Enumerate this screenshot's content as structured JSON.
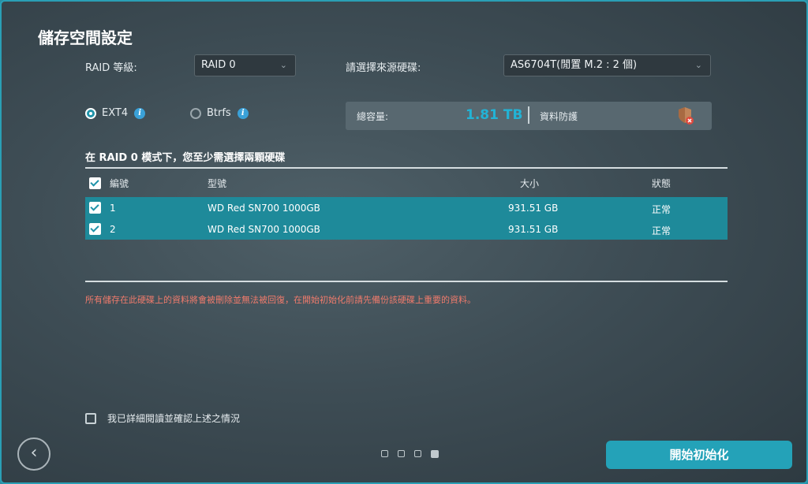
{
  "title": "儲存空間設定",
  "raid": {
    "label": "RAID 等級:",
    "selected": "RAID 0"
  },
  "source": {
    "label": "請選擇來源硬碟:",
    "selected": "AS6704T(閒置 M.2 : 2 個)"
  },
  "filesystem": {
    "options": [
      {
        "label": "EXT4",
        "selected": true
      },
      {
        "label": "Btrfs",
        "selected": false
      }
    ]
  },
  "capacity": {
    "label": "總容量:",
    "value": "1.81 TB",
    "protection_label": "資料防護"
  },
  "heading": "在 RAID 0 模式下，您至少需選擇兩顆硬碟",
  "table": {
    "columns": [
      "編號",
      "型號",
      "大小",
      "狀態"
    ],
    "rows": [
      {
        "id": "1",
        "model": "WD Red SN700 1000GB",
        "size": "931.51 GB",
        "status": "正常",
        "checked": true
      },
      {
        "id": "2",
        "model": "WD Red SN700 1000GB",
        "size": "931.51 GB",
        "status": "正常",
        "checked": true
      }
    ]
  },
  "warning": "所有儲存在此硬碟上的資料將會被刪除並無法被回復，在開始初始化前請先備份該硬碟上重要的資料。",
  "confirm_label": "我已詳細閱讀並確認上述之情況",
  "pager": {
    "total": 4,
    "current": 4
  },
  "primary_button": "開始初始化",
  "icons": {
    "back": "chevron-left-icon",
    "info": "info-icon",
    "shield": "shield-icon"
  },
  "colors": {
    "accent": "#24a2b8",
    "capacity": "#22b3d6",
    "warning": "#f07b6c",
    "selected_row": "#1e8a9a"
  }
}
